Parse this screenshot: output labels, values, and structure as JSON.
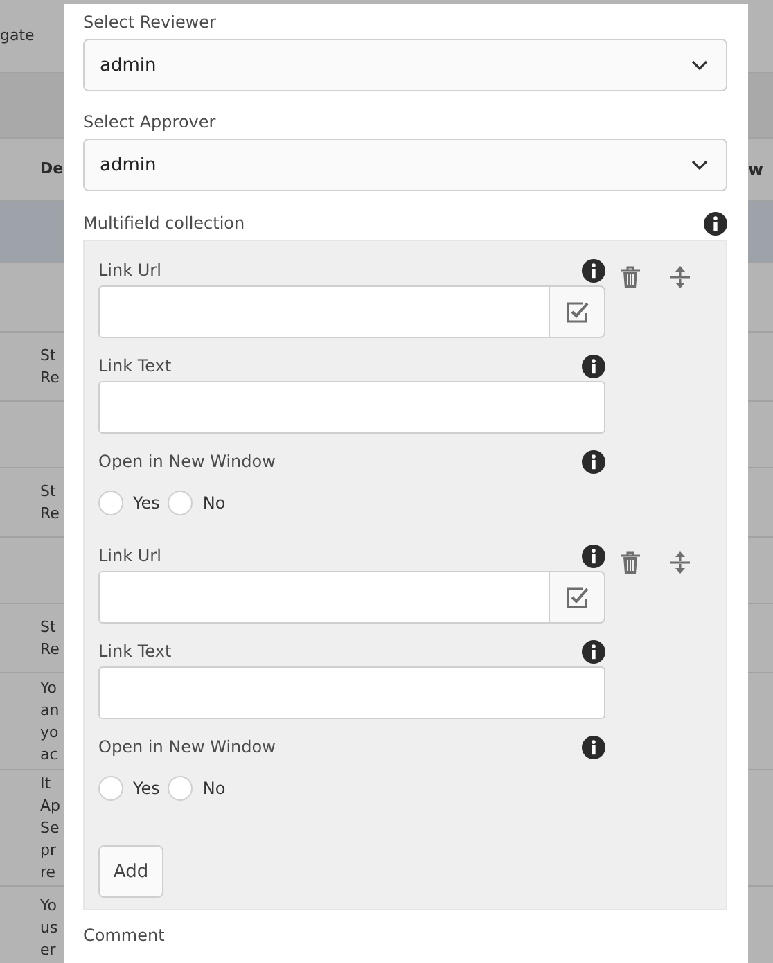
{
  "background": {
    "top_text": "gate",
    "header_left": "De",
    "header_right": "w",
    "rows": [
      {
        "selected": true,
        "lines": []
      },
      {
        "selected": false,
        "lines": []
      },
      {
        "selected": false,
        "lines": [
          "St",
          "Re"
        ]
      },
      {
        "selected": false,
        "lines": []
      },
      {
        "selected": false,
        "lines": [
          "St",
          "Re"
        ]
      },
      {
        "selected": false,
        "lines": []
      },
      {
        "selected": false,
        "lines": [
          "St",
          "Re"
        ]
      },
      {
        "selected": false,
        "lines": [
          "Yo",
          "an",
          "yo",
          "ac"
        ]
      },
      {
        "selected": false,
        "lines": [
          "It",
          "Ap",
          "Se",
          "pr",
          "re"
        ]
      },
      {
        "selected": false,
        "lines": [
          "Yo",
          "us",
          "er"
        ]
      }
    ]
  },
  "dialog": {
    "selects": [
      {
        "label": "Select Reviewer",
        "value": "admin"
      },
      {
        "label": "Select Approver",
        "value": "admin"
      }
    ],
    "multifield": {
      "label": "Multifield collection",
      "items": [
        {
          "fields": [
            {
              "kind": "url",
              "label": "Link Url"
            },
            {
              "kind": "text",
              "label": "Link Text"
            },
            {
              "kind": "radio",
              "label": "Open in New Window",
              "options": [
                {
                  "label": "Yes",
                  "selected": false
                },
                {
                  "label": "No",
                  "selected": false
                }
              ]
            }
          ]
        },
        {
          "fields": [
            {
              "kind": "url",
              "label": "Link Url"
            },
            {
              "kind": "text",
              "label": "Link Text"
            },
            {
              "kind": "radio",
              "label": "Open in New Window",
              "options": [
                {
                  "label": "Yes",
                  "selected": false
                },
                {
                  "label": "No",
                  "selected": false
                }
              ]
            }
          ]
        }
      ],
      "add_button": "Add"
    },
    "next_label": "Comment"
  }
}
